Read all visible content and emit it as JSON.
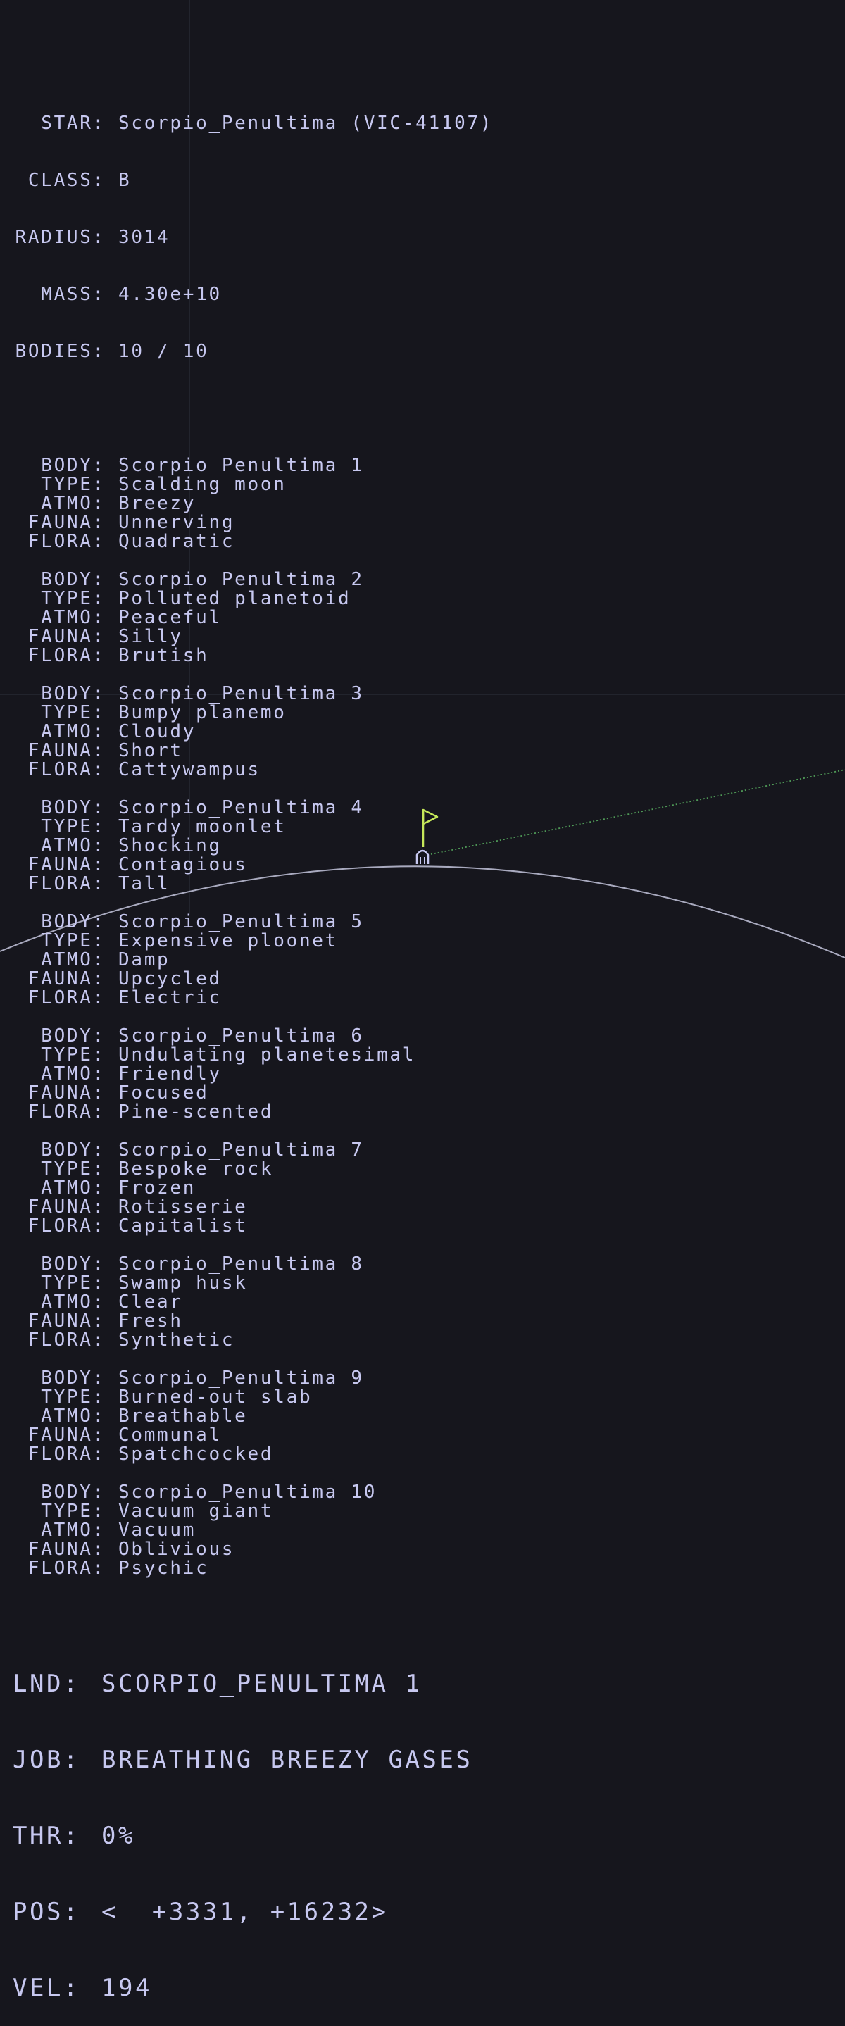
{
  "star": {
    "labels": {
      "star": "STAR:",
      "class": "CLASS:",
      "radius": "RADIUS:",
      "mass": "MASS:",
      "bodies": "BODIES:"
    },
    "name": "Scorpio_Penultima (VIC-41107)",
    "class": "B",
    "radius": "3014",
    "mass": "4.30e+10",
    "bodies": "10 / 10"
  },
  "body_labels": {
    "body": "BODY:",
    "type": "TYPE:",
    "atmo": "ATMO:",
    "fauna": "FAUNA:",
    "flora": "FLORA:"
  },
  "bodies": [
    {
      "body": "Scorpio_Penultima 1",
      "type": "Scalding moon",
      "atmo": "Breezy",
      "fauna": "Unnerving",
      "flora": "Quadratic"
    },
    {
      "body": "Scorpio_Penultima 2",
      "type": "Polluted planetoid",
      "atmo": "Peaceful",
      "fauna": "Silly",
      "flora": "Brutish"
    },
    {
      "body": "Scorpio_Penultima 3",
      "type": "Bumpy planemo",
      "atmo": "Cloudy",
      "fauna": "Short",
      "flora": "Cattywampus"
    },
    {
      "body": "Scorpio_Penultima 4",
      "type": "Tardy moonlet",
      "atmo": "Shocking",
      "fauna": "Contagious",
      "flora": "Tall"
    },
    {
      "body": "Scorpio_Penultima 5",
      "type": "Expensive ploonet",
      "atmo": "Damp",
      "fauna": "Upcycled",
      "flora": "Electric"
    },
    {
      "body": "Scorpio_Penultima 6",
      "type": "Undulating planetesimal",
      "atmo": "Friendly",
      "fauna": "Focused",
      "flora": "Pine-scented"
    },
    {
      "body": "Scorpio_Penultima 7",
      "type": "Bespoke rock",
      "atmo": "Frozen",
      "fauna": "Rotisserie",
      "flora": "Capitalist"
    },
    {
      "body": "Scorpio_Penultima 8",
      "type": "Swamp husk",
      "atmo": "Clear",
      "fauna": "Fresh",
      "flora": "Synthetic"
    },
    {
      "body": "Scorpio_Penultima 9",
      "type": "Burned-out slab",
      "atmo": "Breathable",
      "fauna": "Communal",
      "flora": "Spatchcocked"
    },
    {
      "body": "Scorpio_Penultima 10",
      "type": "Vacuum giant",
      "atmo": "Vacuum",
      "fauna": "Oblivious",
      "flora": "Psychic"
    }
  ],
  "hud": {
    "lnd": {
      "label": "LND:",
      "value": "SCORPIO_PENULTIMA 1"
    },
    "job": {
      "label": "JOB:",
      "value": "BREATHING BREEZY GASES"
    },
    "thr": {
      "label": "THR:",
      "value": "0%"
    },
    "pos": {
      "label": "POS:",
      "value": "<  +3331, +16232>"
    },
    "vel": {
      "label": "VEL:",
      "value": "194"
    }
  },
  "colors": {
    "background": "#16161d",
    "text": "#c7c8f0",
    "surface": "#a9aabf",
    "flag": "#c6e85a",
    "trajectory": "#4f9a57",
    "crosshair": "#262833"
  },
  "icons": {
    "flag": "flag-icon",
    "lander": "lander-icon"
  }
}
